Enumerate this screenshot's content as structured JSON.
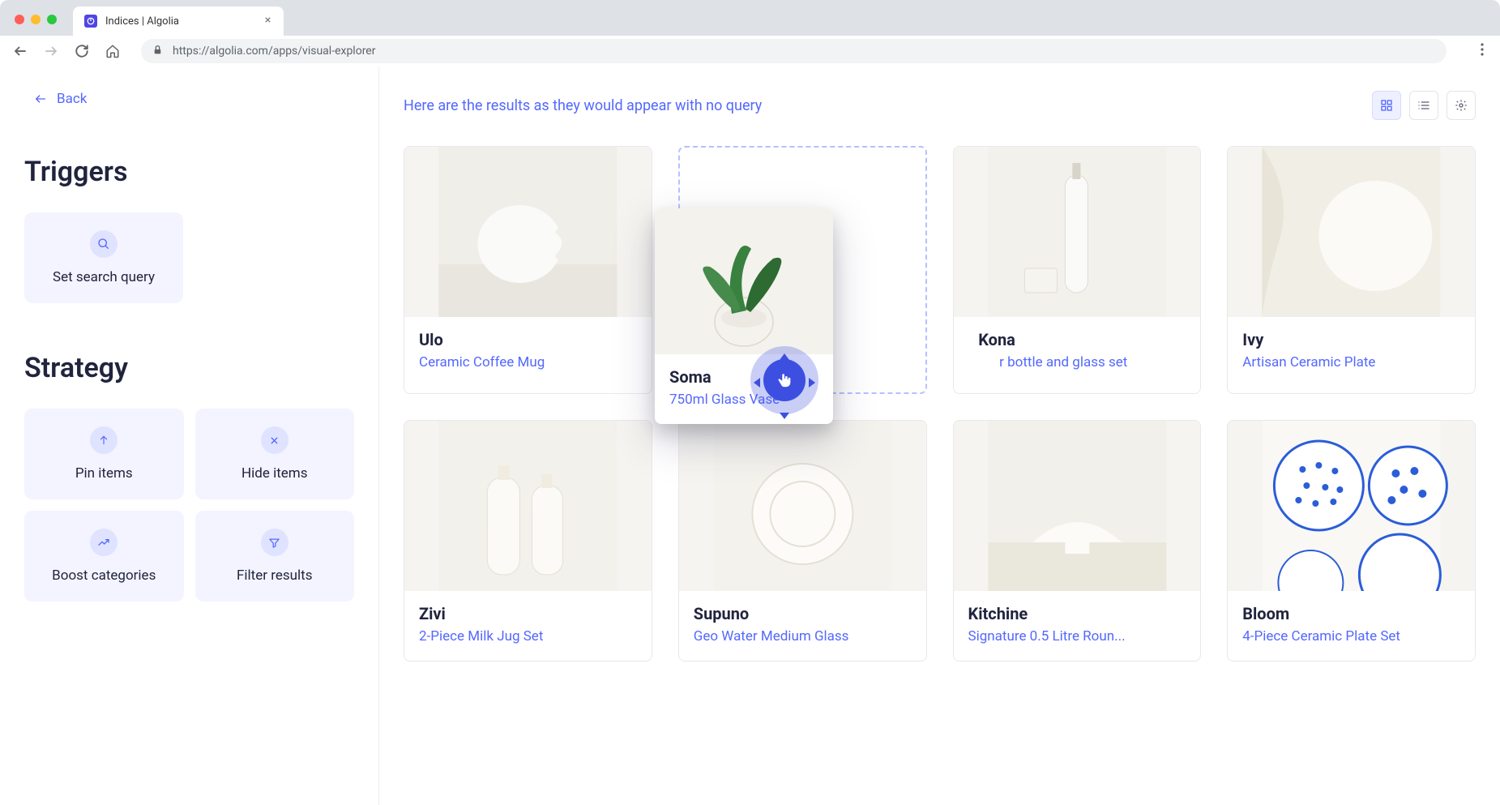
{
  "browser": {
    "tab_title": "Indices | Algolia",
    "url": "https://algolia.com/apps/visual-explorer"
  },
  "sidebar": {
    "back_label": "Back",
    "triggers": {
      "title": "Triggers",
      "cards": [
        {
          "label": "Set search query",
          "icon": "search-icon"
        }
      ]
    },
    "strategy": {
      "title": "Strategy",
      "cards": [
        {
          "label": "Pin items",
          "icon": "arrow-up-icon"
        },
        {
          "label": "Hide items",
          "icon": "x-icon"
        },
        {
          "label": "Boost categories",
          "icon": "trend-icon"
        },
        {
          "label": "Filter results",
          "icon": "filter-icon"
        }
      ]
    }
  },
  "main": {
    "header_text": "Here are the results as they would appear with no query",
    "dragging": {
      "title": "Soma",
      "subtitle": "750ml Glass Vase"
    },
    "products": [
      {
        "title": "Ulo",
        "subtitle": "Ceramic Coffee Mug"
      },
      {
        "title": "",
        "subtitle": "",
        "placeholder": true
      },
      {
        "title": "Kona",
        "subtitle": "Water bottle and glass set",
        "partial": true
      },
      {
        "title": "Ivy",
        "subtitle": "Artisan Ceramic Plate"
      },
      {
        "title": "Zivi",
        "subtitle": "2-Piece Milk Jug Set"
      },
      {
        "title": "Supuno",
        "subtitle": "Geo Water Medium Glass"
      },
      {
        "title": "Kitchine",
        "subtitle": "Signature 0.5 Litre Roun..."
      },
      {
        "title": "Bloom",
        "subtitle": "4-Piece Ceramic Plate Set"
      }
    ]
  }
}
